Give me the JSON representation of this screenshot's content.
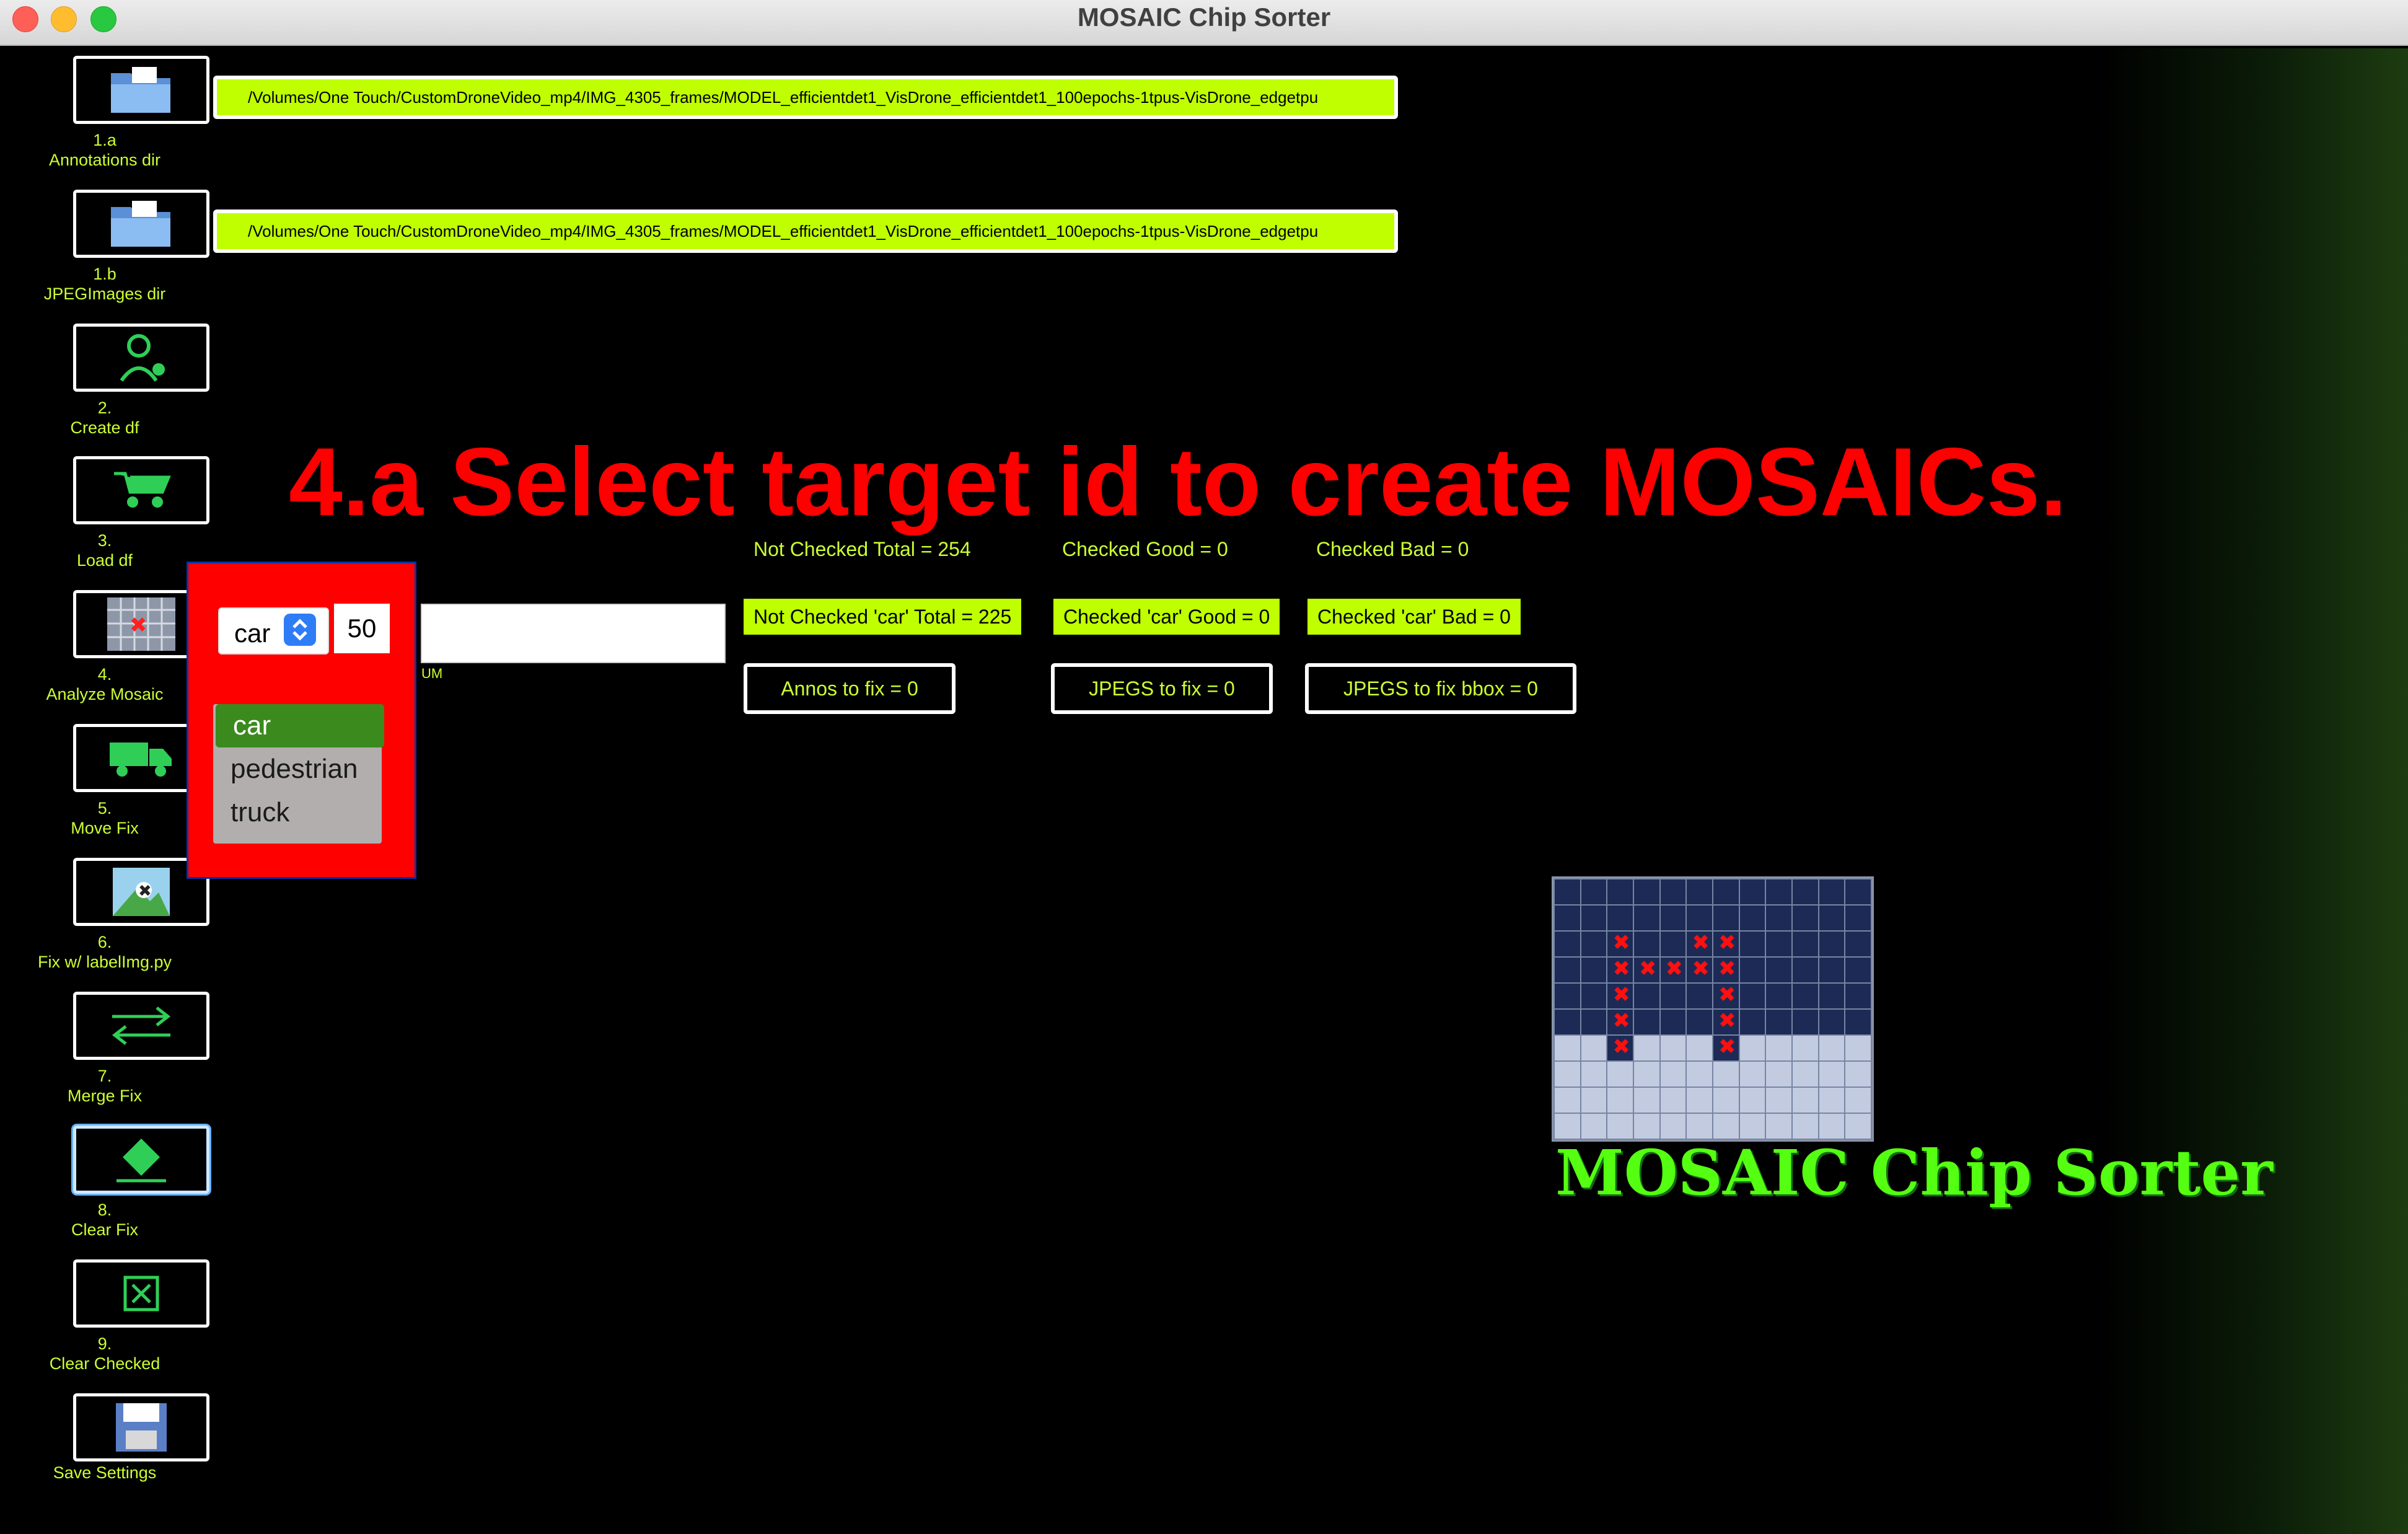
{
  "window": {
    "title": "MOSAIC Chip Sorter"
  },
  "sidebar": {
    "buttons": [
      {
        "num": "1.a",
        "label": "Annotations dir",
        "icon": "folder-icon"
      },
      {
        "num": "1.b",
        "label": "JPEGImages dir",
        "icon": "folder-icon"
      },
      {
        "num": "2.",
        "label": "Create df",
        "icon": "scientist-icon"
      },
      {
        "num": "3.",
        "label": "Load df",
        "icon": "wheelbarrow-icon"
      },
      {
        "num": "4.",
        "label": "Analyze Mosaic",
        "icon": "mosaic-icon"
      },
      {
        "num": "5.",
        "label": "Move Fix",
        "icon": "truck-icon"
      },
      {
        "num": "6.",
        "label": "Fix w/ labelImg.py",
        "icon": "labelimg-icon"
      },
      {
        "num": "7.",
        "label": "Merge Fix",
        "icon": "swap-arrows-icon"
      },
      {
        "num": "8.",
        "label": "Clear Fix",
        "icon": "eraser-icon"
      },
      {
        "num": "9.",
        "label": "Clear Checked",
        "icon": "x-box-icon"
      },
      {
        "num": "",
        "label": "Save Settings",
        "icon": "floppy-icon"
      }
    ]
  },
  "paths": {
    "annotations": "/Volumes/One Touch/CustomDroneVideo_mp4/IMG_4305_frames/MODEL_efficientdet1_VisDrone_efficientdet1_100epochs-1tpus-VisDrone_edgetpu",
    "jpegimages": "/Volumes/One Touch/CustomDroneVideo_mp4/IMG_4305_frames/MODEL_efficientdet1_VisDrone_efficientdet1_100epochs-1tpus-VisDrone_edgetpu"
  },
  "instruction": "4.a  Select target id to create MOSAICs.",
  "stats": {
    "not_checked_total": "Not Checked Total = 254",
    "checked_good": "Checked Good = 0",
    "checked_bad": "Checked Bad = 0",
    "not_checked_class": "Not Checked 'car' Total = 225",
    "checked_class_good": "Checked 'car' Good = 0",
    "checked_class_bad": "Checked 'car' Bad = 0",
    "annos_to_fix": "Annos to fix = 0",
    "jpegs_to_fix": "JPEGS to fix = 0",
    "jpegs_to_fix_bbox": "JPEGS to fix bbox = 0"
  },
  "target_select": {
    "value": "car",
    "options": [
      "car",
      "pedestrian",
      "truck"
    ],
    "count": "50",
    "hint": "UM"
  },
  "logo": {
    "text": "MOSAIC Chip Sorter"
  },
  "colors": {
    "accent": "#bfff00",
    "label": "#ccff33",
    "heading": "#ff0000",
    "logo": "#55ff11"
  }
}
